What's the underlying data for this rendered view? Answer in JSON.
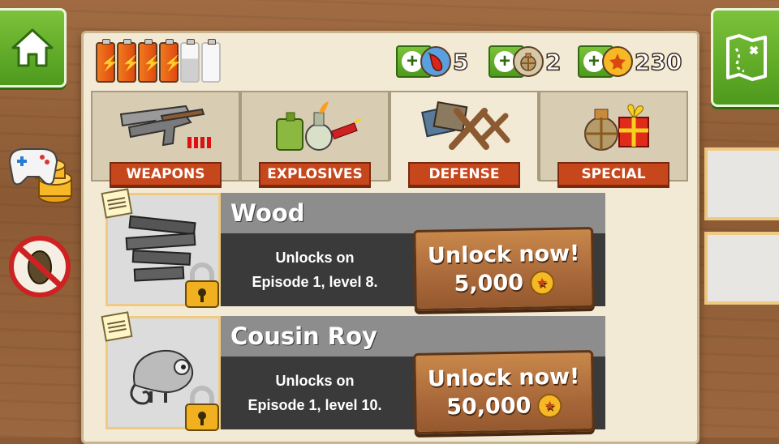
{
  "nav": {
    "home_icon": "home-icon",
    "map_icon": "treasure-map-icon"
  },
  "side": {
    "gamepad_icon": "gamepad-coins-icon",
    "noads_icon": "no-ads-icon"
  },
  "energy": {
    "full": 5,
    "total": 6
  },
  "currencies": [
    {
      "name": "chili",
      "icon": "chili-icon",
      "value": "5"
    },
    {
      "name": "bag",
      "icon": "sack-icon",
      "value": "2"
    },
    {
      "name": "coins",
      "icon": "coin-icon",
      "value": "230"
    }
  ],
  "tabs": [
    {
      "label": "WEAPONS",
      "icon": "guns-icon"
    },
    {
      "label": "EXPLOSIVES",
      "icon": "explosives-icon"
    },
    {
      "label": "DEFENSE",
      "icon": "wood-barricade-icon",
      "active": true
    },
    {
      "label": "SPECIAL",
      "icon": "gift-icon"
    }
  ],
  "items": [
    {
      "title": "Wood",
      "unlock_line1": "Unlocks on",
      "unlock_line2": "Episode 1, level 8.",
      "button_label": "Unlock now!",
      "price": "5,000"
    },
    {
      "title": "Cousin Roy",
      "unlock_line1": "Unlocks on",
      "unlock_line2": "Episode 1, level 10.",
      "button_label": "Unlock now!",
      "price": "50,000"
    }
  ]
}
